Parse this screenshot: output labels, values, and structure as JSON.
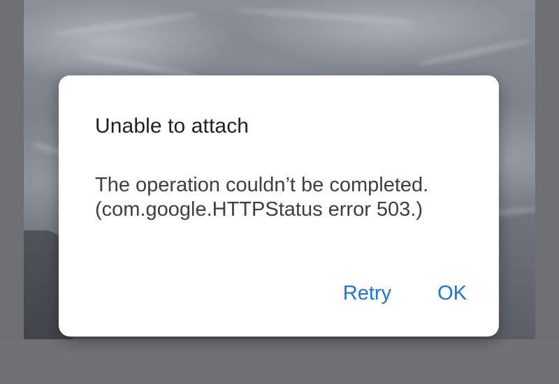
{
  "dialog": {
    "title": "Unable to attach",
    "message_line1": "The operation couldn’t be completed.",
    "message_line2": "(com.google.HTTPStatus error 503.)",
    "retry_label": "Retry",
    "ok_label": "OK"
  },
  "colors": {
    "button_accent": "#1a73e8",
    "title_text": "#202124",
    "body_text": "#3c4043",
    "dialog_background": "#ffffff"
  }
}
